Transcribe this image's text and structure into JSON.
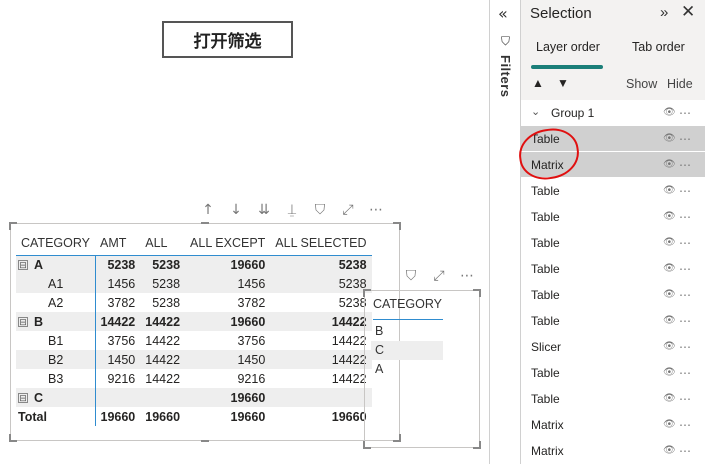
{
  "canvas": {
    "button_label": "打开筛选"
  },
  "matrix": {
    "headers": [
      "CATEGORY",
      "AMT",
      "ALL",
      "ALL EXCEPT",
      "ALL SELECTED"
    ],
    "rows": [
      {
        "label": "A",
        "amt": "5238",
        "all": "5238",
        "all_except": "19660",
        "all_selected": "5238"
      },
      {
        "label": "A1",
        "amt": "1456",
        "all": "5238",
        "all_except": "1456",
        "all_selected": "5238"
      },
      {
        "label": "A2",
        "amt": "3782",
        "all": "5238",
        "all_except": "3782",
        "all_selected": "5238"
      },
      {
        "label": "B",
        "amt": "14422",
        "all": "14422",
        "all_except": "19660",
        "all_selected": "14422"
      },
      {
        "label": "B1",
        "amt": "3756",
        "all": "14422",
        "all_except": "3756",
        "all_selected": "14422"
      },
      {
        "label": "B2",
        "amt": "1450",
        "all": "14422",
        "all_except": "1450",
        "all_selected": "14422"
      },
      {
        "label": "B3",
        "amt": "9216",
        "all": "14422",
        "all_except": "9216",
        "all_selected": "14422"
      },
      {
        "label": "C",
        "amt": "",
        "all": "",
        "all_except": "19660",
        "all_selected": ""
      },
      {
        "label": "Total",
        "amt": "19660",
        "all": "19660",
        "all_except": "19660",
        "all_selected": "19660"
      }
    ],
    "expand_glyph": "⊟"
  },
  "slicer": {
    "header": "CATEGORY",
    "items": [
      "B",
      "C",
      "A"
    ],
    "selected": "C"
  },
  "filters_strip": {
    "label": "Filters"
  },
  "selection_pane": {
    "title": "Selection",
    "tabs": [
      "Layer order",
      "Tab order"
    ],
    "active_tab": "Layer order",
    "show_label": "Show",
    "hide_label": "Hide",
    "items": [
      {
        "label": "Group 1",
        "type": "group"
      },
      {
        "label": "Table",
        "highlighted": true
      },
      {
        "label": "Matrix",
        "highlighted": true
      },
      {
        "label": "Table"
      },
      {
        "label": "Table"
      },
      {
        "label": "Table"
      },
      {
        "label": "Table"
      },
      {
        "label": "Table"
      },
      {
        "label": "Table"
      },
      {
        "label": "Slicer"
      },
      {
        "label": "Table"
      },
      {
        "label": "Table"
      },
      {
        "label": "Matrix"
      },
      {
        "label": "Matrix"
      }
    ],
    "colors": {
      "accent": "#1b7f79",
      "highlight": "#d0d0d0",
      "annotation": "#e01010"
    }
  },
  "icons": [
    "collapse-icon",
    "funnel-icon",
    "focus-icon",
    "more-icon",
    "arrow-up-icon",
    "arrow-down-icon",
    "eye-icon",
    "chevron-down-icon",
    "expand-pane-icon",
    "close-icon"
  ]
}
